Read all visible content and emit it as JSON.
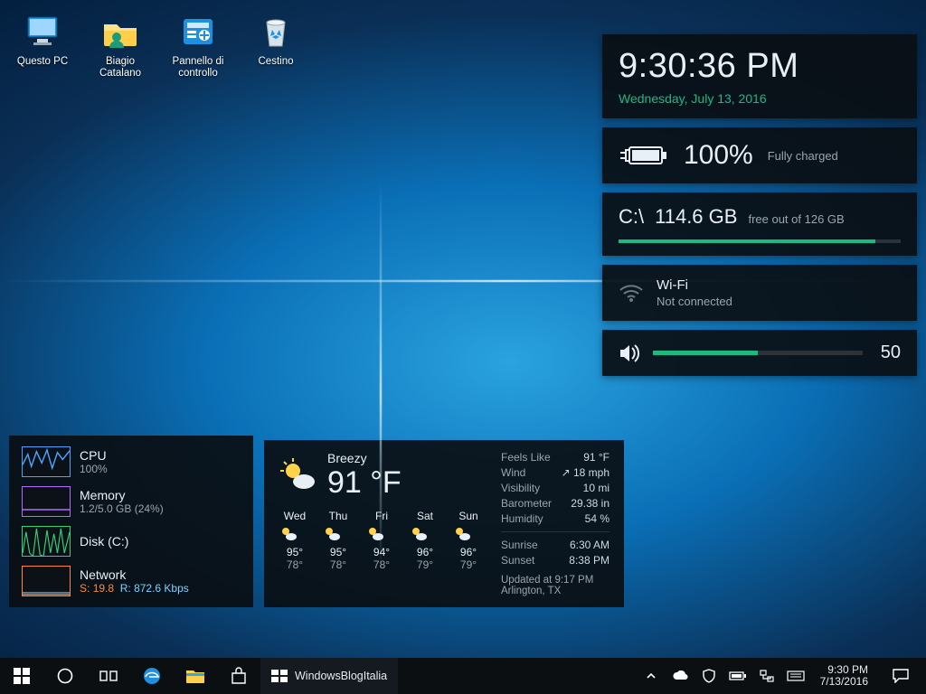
{
  "desktop_icons": [
    {
      "name": "questo-pc",
      "label": "Questo PC"
    },
    {
      "name": "user-folder",
      "label": "Biagio Catalano"
    },
    {
      "name": "control-panel",
      "label": "Pannello di controllo"
    },
    {
      "name": "recycle-bin",
      "label": "Cestino"
    }
  ],
  "clock": {
    "time": "9:30:36 PM",
    "date": "Wednesday, July 13, 2016"
  },
  "battery": {
    "percent": "100%",
    "status": "Fully charged"
  },
  "disk": {
    "drive": "C:\\",
    "free": "114.6 GB",
    "suffix": "free out of 126 GB",
    "fill_pct": 91
  },
  "wifi": {
    "title": "Wi-Fi",
    "status": "Not connected"
  },
  "volume": {
    "value": "50",
    "pct": 50
  },
  "sysmon": {
    "cpu": {
      "title": "CPU",
      "sub": "100%",
      "color": "#4aa3ff"
    },
    "memory": {
      "title": "Memory",
      "sub": "1.2/5.0 GB (24%)",
      "color": "#b66bff"
    },
    "diskc": {
      "title": "Disk (C:)",
      "sub": "",
      "color": "#37d07a"
    },
    "network": {
      "title": "Network",
      "tx_label": "S:",
      "tx": "19.8",
      "rx_label": "R:",
      "rx": "872.6 Kbps",
      "color": "#ff8a3d"
    }
  },
  "weather": {
    "condition": "Breezy",
    "temp": "91 °F",
    "days": [
      {
        "d": "Wed",
        "hi": "95°",
        "lo": "78°"
      },
      {
        "d": "Thu",
        "hi": "95°",
        "lo": "78°"
      },
      {
        "d": "Fri",
        "hi": "94°",
        "lo": "78°"
      },
      {
        "d": "Sat",
        "hi": "96°",
        "lo": "79°"
      },
      {
        "d": "Sun",
        "hi": "96°",
        "lo": "79°"
      }
    ],
    "details": {
      "feels_label": "Feels Like",
      "feels": "91 °F",
      "wind_label": "Wind",
      "wind": "↗ 18 mph",
      "vis_label": "Visibility",
      "vis": "10 mi",
      "baro_label": "Barometer",
      "baro": "29.38 in",
      "hum_label": "Humidity",
      "hum": "54 %",
      "sunrise_label": "Sunrise",
      "sunrise": "6:30 AM",
      "sunset_label": "Sunset",
      "sunset": "8:38 PM"
    },
    "updated": "Updated at 9:17 PM",
    "location": "Arlington, TX"
  },
  "taskbar": {
    "active_title": "WindowsBlogItalia",
    "time": "9:30 PM",
    "date": "7/13/2016"
  }
}
